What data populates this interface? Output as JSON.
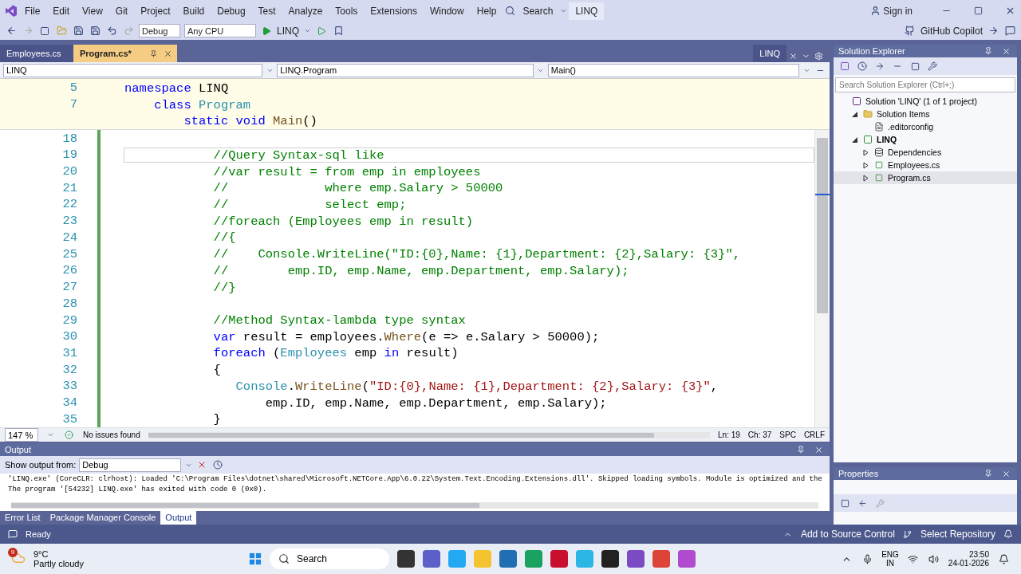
{
  "menu_bar": {
    "items": [
      "File",
      "Edit",
      "View",
      "Git",
      "Project",
      "Build",
      "Debug",
      "Test",
      "Analyze",
      "Tools",
      "Extensions",
      "Window",
      "Help"
    ],
    "search": "Search",
    "solution_name": "LINQ",
    "sign_in": "Sign in"
  },
  "toolbar": {
    "configuration": "Debug",
    "platform": "Any CPU",
    "run_target": "LINQ",
    "copilot": "GitHub Copilot"
  },
  "editor_tabs": [
    {
      "label": "Employees.cs",
      "selected": false
    },
    {
      "label": "Program.cs*",
      "selected": true
    }
  ],
  "editor_project_tab": "LINQ",
  "nav_bar": [
    "LINQ",
    "LINQ.Program",
    "Main()"
  ],
  "sticky_lines": [
    {
      "number": "5",
      "segments": [
        {
          "text": "namespace",
          "kind": "keyword"
        },
        {
          "text": " LINQ",
          "kind": "plain"
        }
      ]
    },
    {
      "number": "7",
      "segments": [
        {
          "text": "    class",
          "kind": "keyword"
        },
        {
          "text": " Program",
          "kind": "type"
        }
      ]
    },
    {
      "segments": [
        {
          "text": "        static void",
          "kind": "keyword"
        },
        {
          "text": " Main",
          "kind": "method"
        },
        {
          "text": "()",
          "kind": "plain"
        }
      ]
    }
  ],
  "code_lines": [
    {
      "number": "18",
      "current": false
    },
    {
      "number": "19",
      "current": true,
      "segments": [
        {
          "text": "            //Query Syntax-sql like",
          "kind": "comment"
        }
      ]
    },
    {
      "number": "20",
      "current": false,
      "segments": [
        {
          "text": "            //var result = from emp in employees",
          "kind": "comment"
        }
      ]
    },
    {
      "number": "21",
      "current": false,
      "segments": [
        {
          "text": "            //             where emp.Salary > 50000",
          "kind": "comment"
        }
      ]
    },
    {
      "number": "22",
      "current": false,
      "segments": [
        {
          "text": "            //             select emp;",
          "kind": "comment"
        }
      ]
    },
    {
      "number": "23",
      "current": false,
      "segments": [
        {
          "text": "            //foreach (Employees emp in result)",
          "kind": "comment"
        }
      ]
    },
    {
      "number": "24",
      "current": false,
      "segments": [
        {
          "text": "            //{",
          "kind": "comment"
        }
      ]
    },
    {
      "number": "25",
      "current": false,
      "segments": [
        {
          "text": "            //    Console.WriteLine(\"ID:{0},Name: {1},Department: {2},Salary: {3}\",",
          "kind": "comment"
        }
      ]
    },
    {
      "number": "26",
      "current": false,
      "segments": [
        {
          "text": "            //        emp.ID, emp.Name, emp.Department, emp.Salary);",
          "kind": "comment"
        }
      ]
    },
    {
      "number": "27",
      "current": false,
      "segments": [
        {
          "text": "            //}",
          "kind": "comment"
        }
      ]
    },
    {
      "number": "28",
      "current": false
    },
    {
      "number": "29",
      "current": false,
      "segments": [
        {
          "text": "            //Method Syntax-lambda type syntax",
          "kind": "comment"
        }
      ]
    },
    {
      "number": "30",
      "current": false,
      "segments": [
        {
          "text": "            var",
          "kind": "keyword"
        },
        {
          "text": " result = employees.",
          "kind": "plain"
        },
        {
          "text": "Where",
          "kind": "method"
        },
        {
          "text": "(e => e.Salary > 50000);",
          "kind": "plain"
        }
      ]
    },
    {
      "number": "31",
      "current": false,
      "segments": [
        {
          "text": "            foreach",
          "kind": "keyword"
        },
        {
          "text": " (",
          "kind": "plain"
        },
        {
          "text": "Employees",
          "kind": "type"
        },
        {
          "text": " emp ",
          "kind": "plain"
        },
        {
          "text": "in",
          "kind": "keyword"
        },
        {
          "text": " result)",
          "kind": "plain"
        }
      ]
    },
    {
      "number": "32",
      "current": false,
      "segments": [
        {
          "text": "            {",
          "kind": "plain"
        }
      ]
    },
    {
      "number": "33",
      "current": false,
      "segments": [
        {
          "text": "               Console",
          "kind": "type"
        },
        {
          "text": ".",
          "kind": "plain"
        },
        {
          "text": "WriteLine",
          "kind": "method"
        },
        {
          "text": "(",
          "kind": "plain"
        },
        {
          "text": "\"ID:{0},Name: {1},Department: {2},Salary: {3}\"",
          "kind": "string"
        },
        {
          "text": ",",
          "kind": "plain"
        }
      ]
    },
    {
      "number": "34",
      "current": false,
      "segments": [
        {
          "text": "                   emp.ID, emp.Name, emp.Department, emp.Salary);",
          "kind": "plain"
        }
      ]
    },
    {
      "number": "35",
      "current": false,
      "segments": [
        {
          "text": "            }",
          "kind": "plain"
        }
      ]
    }
  ],
  "editor_status": {
    "zoom": "147 %",
    "issues": "No issues found",
    "line": "Ln: 19",
    "column": "Ch: 37",
    "spacing": "SPC",
    "line_ending": "CRLF"
  },
  "output": {
    "title": "Output",
    "show_from_label": "Show output from:",
    "source": "Debug",
    "lines": [
      "'LINQ.exe' (CoreCLR: clrhost): Loaded 'C:\\Program Files\\dotnet\\shared\\Microsoft.NETCore.App\\6.0.22\\System.Text.Encoding.Extensions.dll'. Skipped loading symbols. Module is optimized and the",
      "The program '[54232] LINQ.exe' has exited with code 0 (0x0)."
    ]
  },
  "bottom_tabs": [
    {
      "label": "Error List",
      "selected": false
    },
    {
      "label": "Package Manager Console",
      "selected": false
    },
    {
      "label": "Output",
      "selected": true
    }
  ],
  "solution_explorer": {
    "title": "Solution Explorer",
    "search_placeholder": "Search Solution Explorer (Ctrl+;)",
    "tree": [
      {
        "label": "Solution 'LINQ' (1 of 1 project)",
        "kind": "solution",
        "selected": false,
        "children": [
          {
            "label": "Solution Items",
            "kind": "folder",
            "expanded": true,
            "selected": false,
            "children": [
              {
                "label": ".editorconfig",
                "kind": "file",
                "selected": false
              }
            ]
          },
          {
            "label": "LINQ",
            "kind": "project",
            "expanded": true,
            "selected": false,
            "children": [
              {
                "label": "Dependencies",
                "kind": "dependencies",
                "expanded": false,
                "selected": false
              },
              {
                "label": "Employees.cs",
                "kind": "csharp",
                "expanded": false,
                "selected": false
              },
              {
                "label": "Program.cs",
                "kind": "csharp",
                "expanded": false,
                "selected": true
              }
            ]
          }
        ]
      }
    ]
  },
  "properties": {
    "title": "Properties"
  },
  "status_bar": {
    "text": "Ready",
    "source_control": "Add to Source Control",
    "repository": "Select Repository"
  },
  "taskbar": {
    "weather_badge": "9",
    "temperature": "9°C",
    "condition": "Partly cloudy",
    "search": "Search",
    "language": "ENG",
    "region": "IN",
    "time": "23:50",
    "date": "24-01-2026"
  }
}
